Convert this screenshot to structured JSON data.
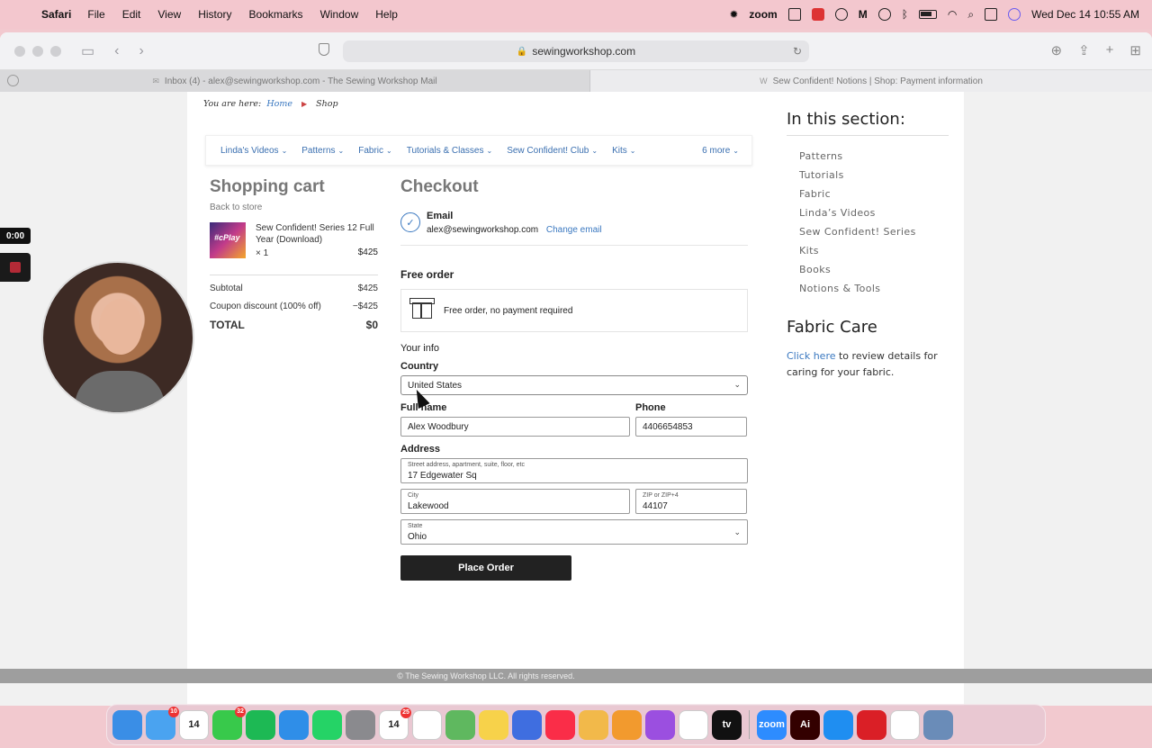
{
  "menubar": {
    "app_name": "Safari",
    "menus": [
      "File",
      "Edit",
      "View",
      "History",
      "Bookmarks",
      "Window",
      "Help"
    ],
    "zoom_label": "zoom",
    "datetime": "Wed Dec 14  10:55 AM"
  },
  "browser": {
    "url": "sewingworkshop.com",
    "tabs": [
      {
        "title": "Inbox (4) - alex@sewingworkshop.com - The Sewing Workshop Mail",
        "active": false
      },
      {
        "title": "Sew Confident! Notions | Shop: Payment information",
        "active": true
      }
    ]
  },
  "breadcrumb": {
    "prefix": "You are here:",
    "home": "Home",
    "current": "Shop"
  },
  "nav": {
    "items": [
      "Linda's Videos",
      "Patterns",
      "Fabric",
      "Tutorials & Classes",
      "Sew Confident! Club",
      "Kits"
    ],
    "more": "6 more"
  },
  "cart": {
    "title": "Shopping cart",
    "back_link": "Back to store",
    "item": {
      "thumb_text": "#cPlay",
      "name": "Sew Confident! Series 12 Full Year (Download)",
      "qty": "× 1",
      "price": "$425"
    },
    "subtotal_label": "Subtotal",
    "subtotal_value": "$425",
    "discount_label": "Coupon discount (100% off)",
    "discount_value": "−$425",
    "total_label": "TOTAL",
    "total_value": "$0"
  },
  "checkout": {
    "title": "Checkout",
    "email_label": "Email",
    "email_value": "alex@sewingworkshop.com",
    "change_email": "Change email",
    "free_order_title": "Free order",
    "free_order_text": "Free order, no payment required",
    "your_info": "Your info",
    "country_label": "Country",
    "country_value": "United States",
    "fullname_label": "Full name",
    "fullname_value": "Alex Woodbury",
    "phone_label": "Phone",
    "phone_value": "4406654853",
    "address_label": "Address",
    "street_label": "Street address, apartment, suite, floor, etc",
    "street_value": "17 Edgewater Sq",
    "city_label": "City",
    "city_value": "Lakewood",
    "zip_label": "ZIP or ZIP+4",
    "zip_value": "44107",
    "state_label": "State",
    "state_value": "Ohio",
    "place_order": "Place Order"
  },
  "sidebar": {
    "section_title": "In this section:",
    "links": [
      "Patterns",
      "Tutorials",
      "Fabric",
      "Linda’s Videos",
      "Sew Confident! Series",
      "Kits",
      "Books",
      "Notions & Tools"
    ],
    "fabric_care_title": "Fabric Care",
    "fabric_care_link": "Click here",
    "fabric_care_text": " to review details for caring for your fabric."
  },
  "footer": {
    "copyright": "© The Sewing Workshop LLC. All rights reserved."
  },
  "recording": {
    "timer": "0:00"
  },
  "dock": {
    "apps": [
      {
        "name": "Finder",
        "color": "#3a8ee6",
        "label": ""
      },
      {
        "name": "Mail",
        "color": "#4aa3f0",
        "label": "",
        "badge": "10"
      },
      {
        "name": "Calendar",
        "color": "#ffffff",
        "label": "14"
      },
      {
        "name": "Messages",
        "color": "#38c94b",
        "label": "",
        "badge": "32"
      },
      {
        "name": "Spotify",
        "color": "#1db954",
        "label": ""
      },
      {
        "name": "Safari",
        "color": "#2f8ee8",
        "label": ""
      },
      {
        "name": "WhatsApp",
        "color": "#25d366",
        "label": ""
      },
      {
        "name": "System Settings",
        "color": "#8a8a8e",
        "label": ""
      },
      {
        "name": "Calendar 2",
        "color": "#ffffff",
        "label": "14",
        "badge": "25"
      },
      {
        "name": "Reminders",
        "color": "#ffffff",
        "label": ""
      },
      {
        "name": "Maps",
        "color": "#5fb85f",
        "label": ""
      },
      {
        "name": "Notes",
        "color": "#f7d24a",
        "label": ""
      },
      {
        "name": "Flower",
        "color": "#3f6ee0",
        "label": ""
      },
      {
        "name": "Music",
        "color": "#fa2d48",
        "label": ""
      },
      {
        "name": "Photos",
        "color": "#f2b94a",
        "label": ""
      },
      {
        "name": "Pages",
        "color": "#f29a2e",
        "label": ""
      },
      {
        "name": "Podcasts",
        "color": "#9b4fe0",
        "label": ""
      },
      {
        "name": "Slack",
        "color": "#ffffff",
        "label": ""
      },
      {
        "name": "Apple TV",
        "color": "#111111",
        "label": "tv"
      },
      {
        "name": "Zoom",
        "color": "#2d8cff",
        "label": "zoom"
      },
      {
        "name": "Illustrator",
        "color": "#330000",
        "label": "Ai"
      },
      {
        "name": "App Store",
        "color": "#1f8ef1",
        "label": ""
      },
      {
        "name": "Creative Cloud",
        "color": "#da1f26",
        "label": ""
      },
      {
        "name": "Chrome",
        "color": "#ffffff",
        "label": ""
      },
      {
        "name": "Preview",
        "color": "#6a8cb8",
        "label": ""
      }
    ]
  }
}
